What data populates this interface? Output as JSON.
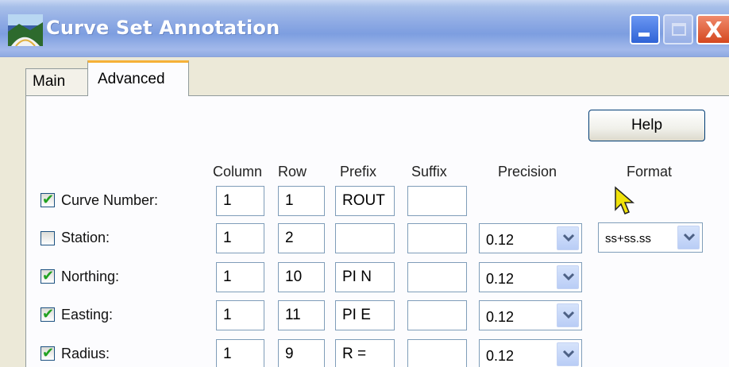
{
  "window": {
    "title": "Curve Set Annotation",
    "icon": "curve-set-app-icon"
  },
  "titlebar": {
    "buttons": [
      {
        "name": "minimize",
        "icon": "minimize-icon"
      },
      {
        "name": "maximize",
        "icon": "maximize-icon"
      },
      {
        "name": "close",
        "icon": "close-icon",
        "glyph": "X"
      }
    ]
  },
  "tabs": [
    {
      "label": "Main",
      "active": false
    },
    {
      "label": "Advanced",
      "active": true
    }
  ],
  "help_label": "Help",
  "columns": {
    "column": "Column",
    "row": "Row",
    "prefix": "Prefix",
    "suffix": "Suffix",
    "precision": "Precision",
    "format": "Format"
  },
  "rows": [
    {
      "label": "Curve Number:",
      "checked": true,
      "column": "1",
      "row": "1",
      "prefix": "ROUT",
      "suffix": "",
      "precision": null
    },
    {
      "label": "Station:",
      "checked": false,
      "column": "1",
      "row": "2",
      "prefix": "",
      "suffix": "",
      "precision": "0.12",
      "format": "ss+ss.ss"
    },
    {
      "label": "Northing:",
      "checked": true,
      "column": "1",
      "row": "10",
      "prefix": "PI N",
      "suffix": "",
      "precision": "0.12"
    },
    {
      "label": "Easting:",
      "checked": true,
      "column": "1",
      "row": "11",
      "prefix": "PI E",
      "suffix": "",
      "precision": "0.12"
    },
    {
      "label": "Radius:",
      "checked": true,
      "column": "1",
      "row": "9",
      "prefix": "R =",
      "suffix": "",
      "precision": "0.12"
    }
  ],
  "colors": {
    "titlebar": "#8eaae4",
    "active_tab_accent": "#f6b138",
    "checkmark": "#21a121",
    "close_button": "#d4471f",
    "field_border": "#7f9db9"
  },
  "cursor_icon": "arrow-cursor-icon"
}
